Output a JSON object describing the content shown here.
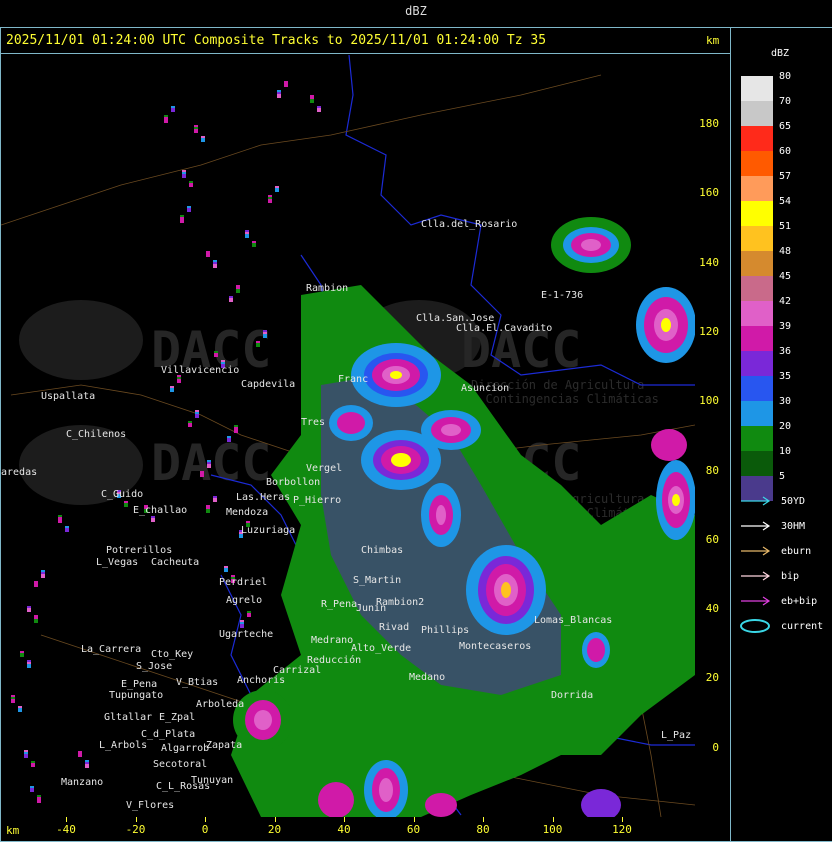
{
  "header": {
    "legend_title_top": "dBZ",
    "track_title": "2025/11/01 01:24:00 UTC Composite Tracks to 2025/11/01 01:24:00 Tz 35",
    "km_label": "km"
  },
  "axes": {
    "x_ticks": [
      "-40",
      "-20",
      "0",
      "20",
      "40",
      "60",
      "80",
      "100",
      "120"
    ],
    "y_ticks": [
      "180",
      "160",
      "140",
      "120",
      "100",
      "80",
      "60",
      "40",
      "20",
      "0"
    ],
    "x_label": "km",
    "y_label": "km"
  },
  "legend": {
    "title": "dBZ",
    "scale": [
      {
        "value": "80",
        "color": "#e6e6e6"
      },
      {
        "value": "70",
        "color": "#c8c8c8"
      },
      {
        "value": "65",
        "color": "#ff2a1a"
      },
      {
        "value": "60",
        "color": "#ff5a00"
      },
      {
        "value": "57",
        "color": "#ff9b5a"
      },
      {
        "value": "54",
        "color": "#ffff00"
      },
      {
        "value": "51",
        "color": "#ffc21f"
      },
      {
        "value": "48",
        "color": "#d58a2e"
      },
      {
        "value": "45",
        "color": "#c96a8a"
      },
      {
        "value": "42",
        "color": "#e060c8"
      },
      {
        "value": "39",
        "color": "#d01aa8"
      },
      {
        "value": "36",
        "color": "#7a28d8"
      },
      {
        "value": "35",
        "color": "#2856f0"
      },
      {
        "value": "30",
        "color": "#1e96e6"
      },
      {
        "value": "20",
        "color": "#108a10"
      },
      {
        "value": "10",
        "color": "#0a5a0a"
      },
      {
        "value": "5",
        "color": "#4a3a8c"
      }
    ],
    "tracks": [
      {
        "label": "50YD",
        "color": "#3ad7e6"
      },
      {
        "label": "30HM",
        "color": "#ffffff"
      },
      {
        "label": "eburn",
        "color": "#e6b86a"
      },
      {
        "label": "bip",
        "color": "#ffd6e0"
      },
      {
        "label": "eb+bip",
        "color": "#e040e0"
      },
      {
        "label": "current",
        "color": "#3ad7e6"
      }
    ]
  },
  "places": [
    "Clla.del_Rosario",
    "Rambion",
    "Clla.San.Jose",
    "Clla.El.Cavadito",
    "E-1-736",
    "Villavicencio",
    "Uspallata",
    "Capdevila",
    "Franc",
    "Asuncion",
    "C_Chilenos",
    "Tres",
    "Borbollon",
    "Vergel",
    "P_Hierro",
    "Las.Heras",
    "Mendoza",
    "C_Guido",
    "E_challao",
    "Luzuriaga",
    "Potrerillos",
    "Cacheuta",
    "L_Vegas",
    "Perdriel",
    "Agrelo",
    "S_Martin",
    "R_Pena",
    "Junin",
    "Ugarteche",
    "Medrano",
    "Rivad",
    "Phillips",
    "La_Carrera",
    "Cto_Key",
    "S_Jose",
    "Anchoris",
    "E_Pena",
    "Tupungato",
    "V_Btias",
    "Arboleda",
    "Gltallar",
    "E_Zpal",
    "C_d_Plata",
    "L_Arbols",
    "Zapata",
    "Algarrob",
    "Secotoral",
    "Tunuyan",
    "C_L_Rosas",
    "Manzano",
    "V_Flores",
    "Carrizal",
    "Lomas_Blancas",
    "Dorrida",
    "L_Paz",
    "Chimbas",
    "Reducción",
    "Alto_Verde",
    "Medano",
    "Montecaseros",
    "Rambion2",
    "aredas"
  ],
  "watermark": {
    "brand": "DACC",
    "line1": "Dirección de Agricultura",
    "line2": "y Contingencias Climáticas"
  }
}
